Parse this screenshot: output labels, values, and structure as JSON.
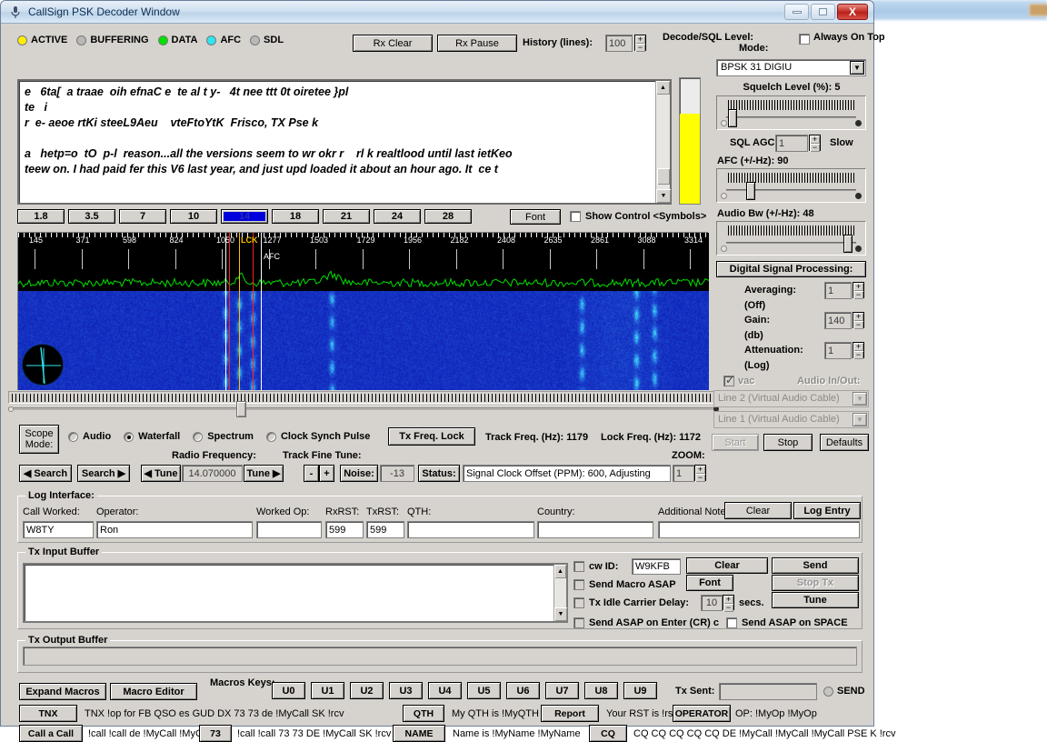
{
  "window": {
    "title": "CallSign PSK Decoder Window",
    "icon": "microphone-icon",
    "minimize": "minimize-icon",
    "maximize": "maximize-icon",
    "close": "X"
  },
  "status_leds": [
    {
      "label": "ACTIVE",
      "color": "#ffee00"
    },
    {
      "label": "BUFFERING",
      "color": "#b8b8b8"
    },
    {
      "label": "DATA",
      "color": "#00e000"
    },
    {
      "label": "AFC",
      "color": "#2ee6f0"
    },
    {
      "label": "SDL",
      "color": "#b8b8b8"
    }
  ],
  "toolbar": {
    "rx_clear": "Rx Clear",
    "rx_pause": "Rx Pause",
    "history_label": "History (lines):",
    "history_value": "100",
    "decode_sql_label": "Decode/SQL Level:",
    "sql_meter_percent": 72,
    "sql_meter_color": "#ffff00"
  },
  "rx_text": "e   6ta[  a traae  oih efnaC e  te al t y-   4t nee ttt 0t oiretee }pl\nte   i\nr  e- aeoe rtKi steeL9Aeu    vteFtoYtK  Frisco, TX Pse k\n\na   hetp=o  tO  p-l  reason...all the versions seem to wr okr r    rl k realtlood until last ietKeo\nteew on. I had paid fer this V6 last year, and just upd loaded it about an hour ago. It  ce t",
  "band_buttons": [
    {
      "label": "1.8",
      "selected": false
    },
    {
      "label": "3.5",
      "selected": false
    },
    {
      "label": "7",
      "selected": false
    },
    {
      "label": "10",
      "selected": false
    },
    {
      "label": "14",
      "selected": true
    },
    {
      "label": "18",
      "selected": false
    },
    {
      "label": "21",
      "selected": false
    },
    {
      "label": "24",
      "selected": false
    },
    {
      "label": "28",
      "selected": false
    }
  ],
  "band_row": {
    "font_button": "Font",
    "show_control_label": "Show Control  <Symbols>",
    "show_control_checked": false
  },
  "spectrum": {
    "tick_labels": [
      "145",
      "371",
      "598",
      "824",
      "1050",
      "1277",
      "1503",
      "1729",
      "1956",
      "2182",
      "2408",
      "2635",
      "2861",
      "3088",
      "3314"
    ],
    "lock_marker_label": "LCK",
    "afc_label": "AFC",
    "lock_marker_color": "#ffffff",
    "afc_marker_color": "#ff2020",
    "tune_marker_color": "#ffc000",
    "trace_color": "#00e000",
    "waterfall_base_color": "#0b22e0"
  },
  "right_panel": {
    "always_on_top_label": "Always On Top",
    "always_on_top_checked": false,
    "mode_label": "Mode:",
    "mode_value": "BPSK 31 DIGIU",
    "squelch_label": "Squelch Level (%): 5",
    "squelch_pos_pct": 6,
    "sql_agc_label": "SQL AGC:",
    "sql_agc_value": "1",
    "sql_agc_speed": "Slow",
    "afc_label": "AFC (+/-Hz): 90",
    "afc_pos_pct": 20,
    "audio_bw_label": "Audio Bw (+/-Hz): 48",
    "audio_bw_pos_pct": 92,
    "dsp_label": "Digital Signal Processing:",
    "averaging_label": "Averaging:",
    "averaging_value": "1",
    "averaging_unit": "(Off)",
    "gain_label": "Gain:",
    "gain_value": "140",
    "gain_unit": "(db)",
    "attenuation_label": "Attenuation:",
    "attenuation_value": "1",
    "attenuation_unit": "(Log)",
    "vac_label": "vac",
    "vac_checked": true,
    "audio_inout_label": "Audio In/Out:",
    "audio_in_value": "Line 2 (Virtual Audio Cable)",
    "audio_out_value": "Line 1 (Virtual Audio Cable)",
    "start_button": "Start",
    "stop_button": "Stop",
    "defaults_button": "Defaults"
  },
  "scope_row": {
    "scope_mode_button": "Scope Mode:",
    "options": [
      {
        "label": "Audio",
        "selected": false
      },
      {
        "label": "Waterfall",
        "selected": true
      },
      {
        "label": "Spectrum",
        "selected": false
      },
      {
        "label": "Clock Synch Pulse",
        "selected": false
      }
    ],
    "tx_freq_lock": "Tx Freq. Lock",
    "track_freq_label": "Track Freq. (Hz): 1179",
    "lock_freq_label": "Lock Freq. (Hz): 1172"
  },
  "tune_row": {
    "radio_frequency_label": "Radio Frequency:",
    "track_fine_tune_label": "Track Fine Tune:",
    "search_left": "◀ Search",
    "search_right": "Search ▶",
    "tune_left": "◀ Tune",
    "frequency_value": "14.070000",
    "tune_right": "Tune ▶",
    "fine_minus": "-",
    "fine_plus": "+",
    "noise_button": "Noise:",
    "noise_value": "-13",
    "status_button": "Status:",
    "status_value": "Signal Clock Offset (PPM): 600, Adjusting",
    "zoom_label": "ZOOM:",
    "zoom_value": "1"
  },
  "log_interface": {
    "title": "Log Interface:",
    "fields": [
      {
        "label": "Call Worked:",
        "value": "W8TY"
      },
      {
        "label": "Operator:",
        "value": "Ron"
      },
      {
        "label": "Worked Op:",
        "value": ""
      },
      {
        "label": "RxRST:",
        "value": "599"
      },
      {
        "label": "TxRST:",
        "value": "599"
      },
      {
        "label": "QTH:",
        "value": ""
      },
      {
        "label": "Country:",
        "value": ""
      },
      {
        "label": "Additional Notes:",
        "value": ""
      }
    ],
    "clear_button": "Clear",
    "log_entry_button": "Log Entry"
  },
  "tx_input": {
    "title": "Tx Input Buffer",
    "value": "",
    "cw_id_label": "cw ID:",
    "cw_id_checked": false,
    "cw_id_value": "W9KFB",
    "send_macro_asap_label": "Send Macro ASAP",
    "send_macro_asap_checked": false,
    "tx_idle_label": "Tx Idle Carrier Delay:",
    "tx_idle_checked": false,
    "tx_idle_value": "10",
    "secs_label": "secs.",
    "send_asap_cr_label": "Send ASAP on Enter (CR) c",
    "send_asap_cr_checked": false,
    "send_asap_space_label": "Send ASAP on SPACE",
    "send_asap_space_checked": false,
    "clear_button": "Clear",
    "font_button": "Font",
    "send_button": "Send",
    "stop_tx_button": "Stop Tx",
    "tune_button": "Tune"
  },
  "tx_output": {
    "title": "Tx Output Buffer",
    "value": ""
  },
  "macros": {
    "expand_macros": "Expand Macros",
    "macro_editor": "Macro Editor",
    "macros_keys_label": "Macros Keys:",
    "u_keys": [
      "U0",
      "U1",
      "U2",
      "U3",
      "U4",
      "U5",
      "U6",
      "U7",
      "U8",
      "U9"
    ],
    "tx_sent_label": "Tx Sent:",
    "tx_sent_value": "",
    "send_indicator_label": "SEND",
    "rows": [
      [
        {
          "button": "TNX",
          "text": "TNX !op for FB QSO es GUD DX 73 73  de !MyCall SK !rcv"
        },
        {
          "button": "QTH",
          "text": "My QTH is !MyQTH !MyQTH"
        },
        {
          "button": "Report",
          "text": "Your RST is !rst !rst"
        },
        {
          "button": "OPERATOR",
          "text": "OP: !MyOp !MyOp"
        }
      ],
      [
        {
          "button": "Call a Call",
          "text": "!call !call de !MyCall !MyCall"
        },
        {
          "button": "73",
          "text": "!call !call 73 73 DE !MyCall SK !rcv"
        },
        {
          "button": "NAME",
          "text": "Name is !MyName !MyName"
        },
        {
          "button": "CQ",
          "text": "CQ CQ CQ CQ CQ DE !MyCall !MyCall !MyCall PSE K !rcv"
        }
      ]
    ]
  }
}
